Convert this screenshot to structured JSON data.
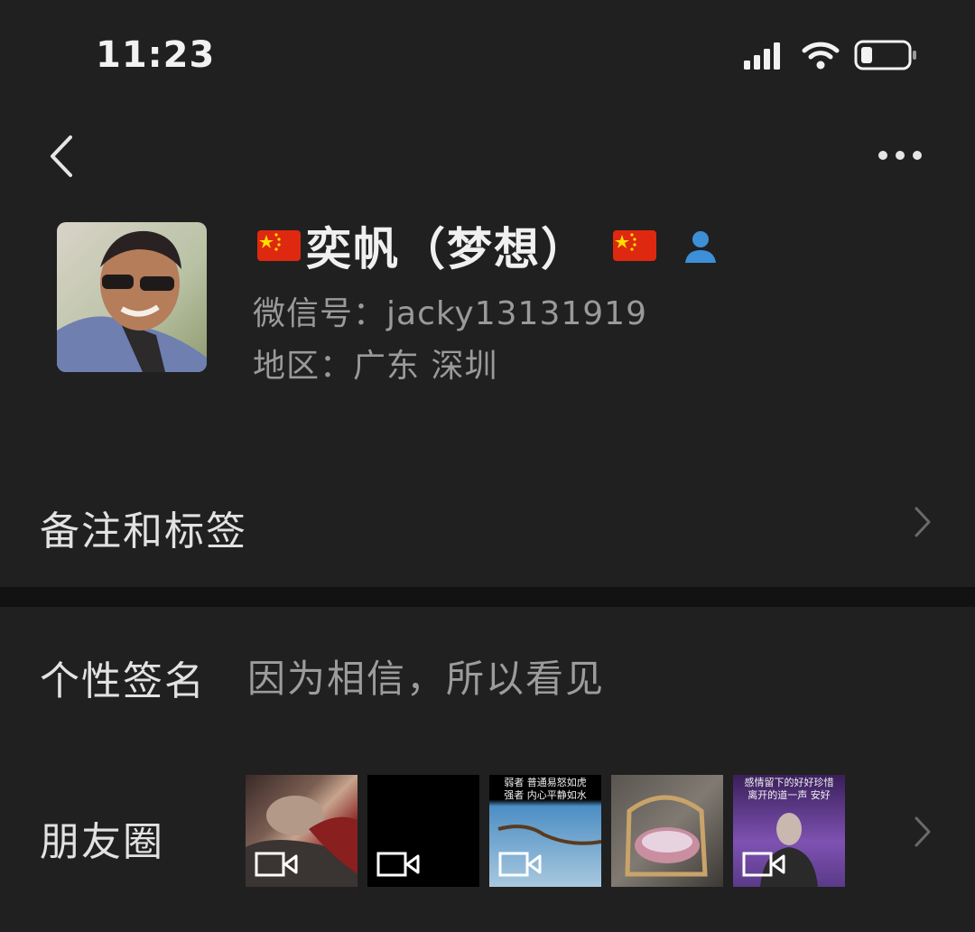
{
  "status_bar": {
    "time": "11:23"
  },
  "profile": {
    "name": "奕帆（梦想）",
    "flag_left": "china-flag",
    "flag_right": "china-flag",
    "wechat_id_label": "微信号：",
    "wechat_id": "jacky13131919",
    "region_label": "地区：",
    "region": "广东 深圳"
  },
  "rows": {
    "notes_tags": "备注和标签",
    "signature_label": "个性签名",
    "signature_value": "因为相信，所以看见",
    "moments_label": "朋友圈"
  },
  "moments": {
    "thumbs": [
      {
        "caption": ""
      },
      {
        "caption": ""
      },
      {
        "caption": "弱者 普通易怒如虎\n强者 内心平静如水"
      },
      {
        "caption": ""
      },
      {
        "caption": "感情留下的好好珍惜\n离开的道一声 安好"
      }
    ]
  },
  "colors": {
    "background": "#202020",
    "divider": "#121212",
    "accent_user_icon": "#3d8fd8"
  }
}
